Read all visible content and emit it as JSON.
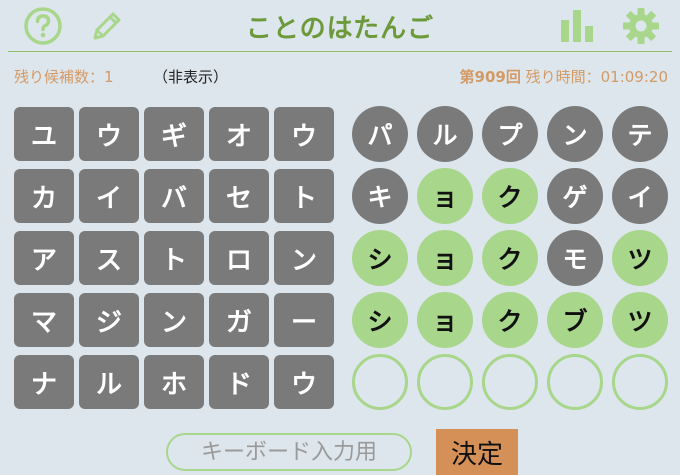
{
  "header": {
    "title": "ことのはたんご",
    "icons": [
      "help-icon",
      "pencil-icon",
      "stats-icon",
      "gear-icon"
    ],
    "accent_color": "#8fbf6a"
  },
  "status": {
    "remaining_label": "残り候補数：1",
    "hidden_note": "（非表示）",
    "round": "第909回",
    "time_label": " 残り時間：01:09:20"
  },
  "keyboard": {
    "rows": [
      [
        "ユ",
        "ウ",
        "ギ",
        "オ",
        "ウ"
      ],
      [
        "カ",
        "イ",
        "バ",
        "セ",
        "ト"
      ],
      [
        "ア",
        "ス",
        "ト",
        "ロ",
        "ン"
      ],
      [
        "マ",
        "ジ",
        "ン",
        "ガ",
        "ー"
      ],
      [
        "ナ",
        "ル",
        "ホ",
        "ド",
        "ウ"
      ]
    ]
  },
  "board": {
    "rows": [
      [
        {
          "ch": "パ",
          "s": "gray"
        },
        {
          "ch": "ル",
          "s": "gray"
        },
        {
          "ch": "プ",
          "s": "gray"
        },
        {
          "ch": "ン",
          "s": "gray"
        },
        {
          "ch": "テ",
          "s": "gray"
        }
      ],
      [
        {
          "ch": "キ",
          "s": "gray"
        },
        {
          "ch": "ョ",
          "s": "green"
        },
        {
          "ch": "ク",
          "s": "green"
        },
        {
          "ch": "ゲ",
          "s": "gray"
        },
        {
          "ch": "イ",
          "s": "gray"
        }
      ],
      [
        {
          "ch": "シ",
          "s": "green"
        },
        {
          "ch": "ョ",
          "s": "green"
        },
        {
          "ch": "ク",
          "s": "green"
        },
        {
          "ch": "モ",
          "s": "gray"
        },
        {
          "ch": "ツ",
          "s": "green"
        }
      ],
      [
        {
          "ch": "シ",
          "s": "green"
        },
        {
          "ch": "ョ",
          "s": "green"
        },
        {
          "ch": "ク",
          "s": "green"
        },
        {
          "ch": "ブ",
          "s": "green"
        },
        {
          "ch": "ツ",
          "s": "green"
        }
      ],
      [
        {
          "ch": "",
          "s": "empty"
        },
        {
          "ch": "",
          "s": "empty"
        },
        {
          "ch": "",
          "s": "empty"
        },
        {
          "ch": "",
          "s": "empty"
        },
        {
          "ch": "",
          "s": "empty"
        }
      ]
    ]
  },
  "controls": {
    "keyboard_input_placeholder": "キーボード入力用",
    "submit_label": "決定"
  }
}
